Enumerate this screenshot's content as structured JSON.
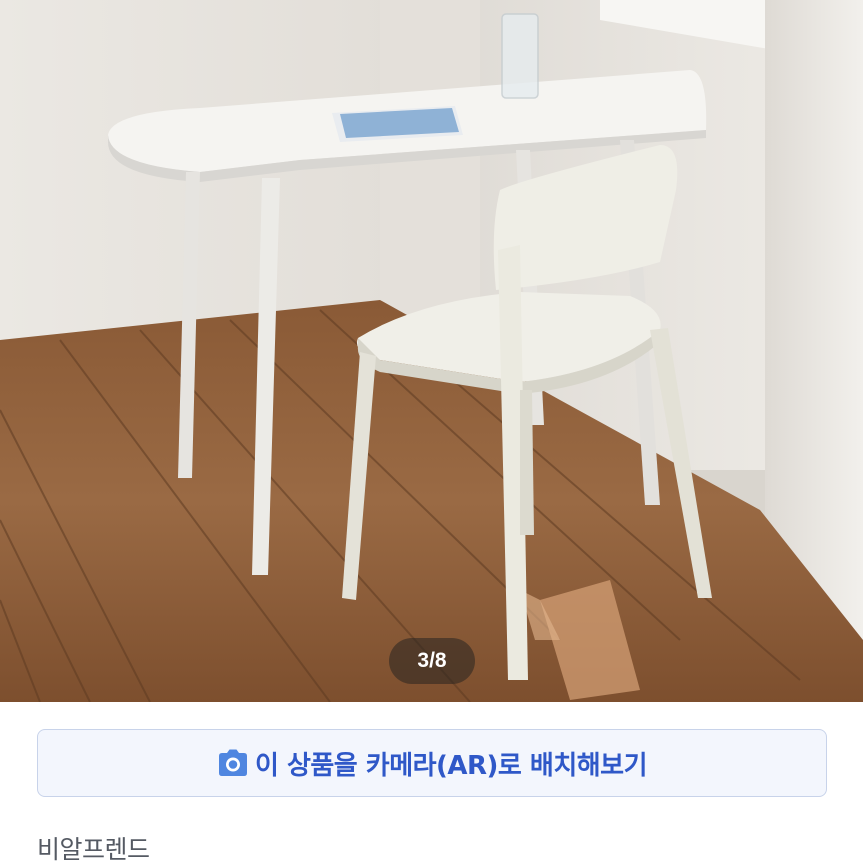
{
  "product_image": {
    "description_icon": "product-photo",
    "page_indicator": "3/8"
  },
  "ar_button": {
    "icon": "camera-icon",
    "label": "이 상품을 카메라(AR)로 배치해보기",
    "text_color": "#2f58c8",
    "background": "#f3f6fd"
  },
  "brand": {
    "name": "비알프렌드"
  }
}
